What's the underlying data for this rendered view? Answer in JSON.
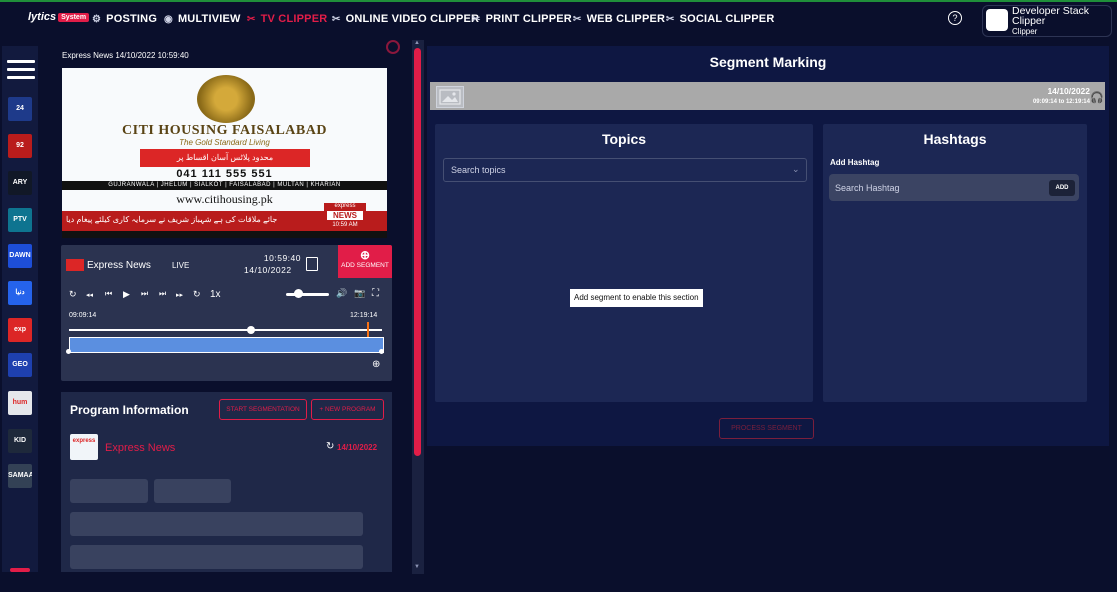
{
  "topnav": {
    "logo": "lytics",
    "logo_badge": "System",
    "items": [
      {
        "label": "POSTING",
        "icon": "gear-icon",
        "glyph": "⚙"
      },
      {
        "label": "MULTIVIEW",
        "icon": "globe-icon",
        "glyph": "◉"
      },
      {
        "label": "TV CLIPPER",
        "icon": "scissors-icon",
        "glyph": "✂"
      },
      {
        "label": "ONLINE VIDEO CLIPPER",
        "icon": "scissors-icon",
        "glyph": "✂"
      },
      {
        "label": "PRINT CLIPPER",
        "icon": "scissors-icon",
        "glyph": "✂"
      },
      {
        "label": "WEB CLIPPER",
        "icon": "scissors-icon",
        "glyph": "✂"
      },
      {
        "label": "SOCIAL CLIPPER",
        "icon": "scissors-icon",
        "glyph": "✂"
      }
    ],
    "active": "TV CLIPPER",
    "help_glyph": "?",
    "user_name": "Developer Stack Clipper",
    "user_role": "Clipper"
  },
  "channels": [
    {
      "name": "24 News HD",
      "label": "24",
      "color": "#1e3a8a"
    },
    {
      "name": "92 News",
      "label": "92",
      "color": "#b91c1c"
    },
    {
      "name": "ARY News",
      "label": "ARY",
      "color": "#111827"
    },
    {
      "name": "PTV News",
      "label": "PTV",
      "color": "#0e7490"
    },
    {
      "name": "Dawn News",
      "label": "DAWN",
      "color": "#1d4ed8"
    },
    {
      "name": "Dunya News",
      "label": "دنیا",
      "color": "#2563eb"
    },
    {
      "name": "Express News",
      "label": "exp",
      "color": "#dc2626"
    },
    {
      "name": "Geo News",
      "label": "GEO",
      "color": "#1e40af"
    },
    {
      "name": "Hum News",
      "label": "hum",
      "color": "#e5e7eb"
    },
    {
      "name": "Kidz Zone",
      "label": "KID",
      "color": "#1e293b"
    },
    {
      "name": "Samaa",
      "label": "SAMAA",
      "color": "#334155"
    }
  ],
  "player": {
    "header": "Express News  14/10/2022 10:59:40",
    "ad": {
      "title": "CITI HOUSING FAISALABAD",
      "subtitle": "The Gold Standard Living",
      "banner": "محدود پلاٹس آسان اقساط پر",
      "phone": "041 111 555 551",
      "cities": "GUJRANWALA  |  JHELUM  |  SIALKOT  |  FAISALABAD  |  MULTAN  |  KHARIAN",
      "url": "www.citihousing.pk"
    },
    "ticker": "جائے ملاقات کی ہے شہباز شریف نے سرمایہ کاری کیلئے پیغام دیا",
    "ticker_brand": "express",
    "ticker_news": "NEWS",
    "ticker_time": "10:59 AM"
  },
  "controls": {
    "channel": "Express News",
    "live": "LIVE",
    "time": "10:59:40",
    "date": "14/10/2022",
    "add_segment": "ADD SEGMENT",
    "add_glyph": "⊕",
    "speed": "1x",
    "timeline_start": "09:09:14",
    "timeline_end": "12:19:14",
    "volume_level": 0.3,
    "playhead_fraction": 0.58,
    "glyphs": {
      "replay": "↻",
      "rewind": "◂◂",
      "prev": "⏮",
      "play": "▶",
      "next": "⏭",
      "forward": "▸▸",
      "loop": "↻",
      "volume": "🔊",
      "camera": "📷",
      "fullscreen": "⛶",
      "zoom": "⊕"
    }
  },
  "program": {
    "title": "Program Information",
    "start_btn": "START SEGMENTATION",
    "new_btn": "+ NEW PROGRAM",
    "channel": "Express News",
    "logo_text": "express",
    "date": "14/10/2022",
    "refresh_glyph": "↻"
  },
  "segment": {
    "title": "Segment Marking",
    "date": "14/10/2022",
    "range": "09:09:14 to 12:19:14",
    "headphone_glyph": "🎧",
    "topics": {
      "title": "Topics",
      "placeholder": "Search topics",
      "chevron": "⌄"
    },
    "hashtags": {
      "title": "Hashtags",
      "label": "Add Hashtag",
      "placeholder": "Search Hashtag",
      "add": "ADD"
    },
    "overlay": "Add segment to enable this section",
    "process_btn": "PROCESS SEGMENT"
  }
}
